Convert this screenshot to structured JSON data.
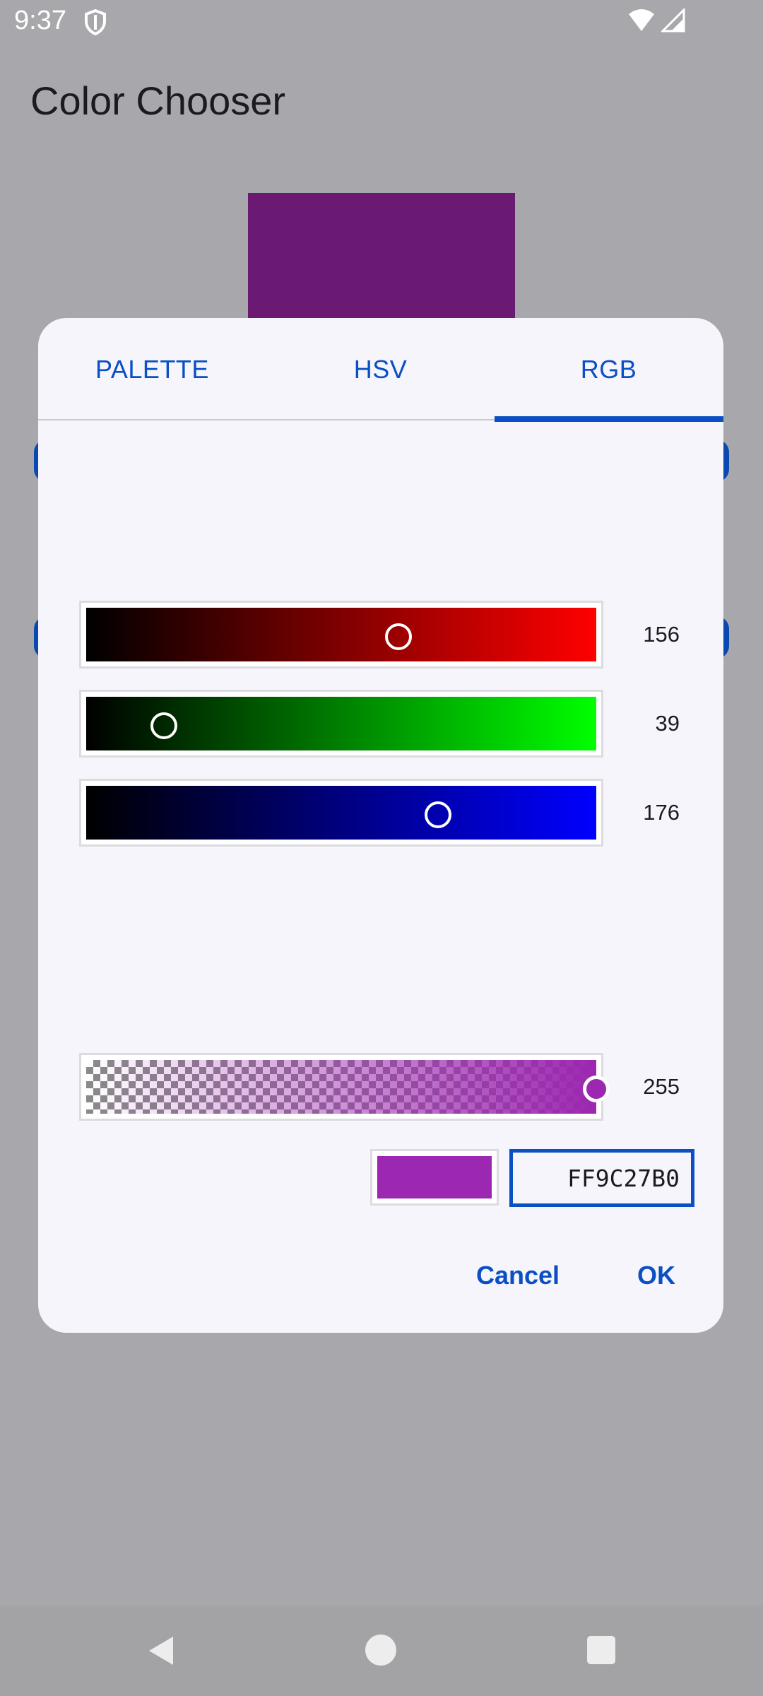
{
  "status_bar": {
    "time": "9:37"
  },
  "app": {
    "title": "Color Chooser"
  },
  "dialog": {
    "tabs": [
      {
        "label": "PALETTE",
        "selected": false
      },
      {
        "label": "HSV",
        "selected": false
      },
      {
        "label": "RGB",
        "selected": true
      }
    ],
    "sliders": {
      "red": {
        "value": "156",
        "fraction": 0.612
      },
      "green": {
        "value": "39",
        "fraction": 0.153
      },
      "blue": {
        "value": "176",
        "fraction": 0.69
      },
      "alpha": {
        "value": "255",
        "fraction": 1.0
      }
    },
    "selected_color": "#9C27B0",
    "hex_value": "FF9C27B0",
    "buttons": {
      "cancel": "Cancel",
      "ok": "OK"
    }
  },
  "colors": {
    "accent": "#0A4FC4",
    "preview_behind_dialog": "#6A1A72",
    "dialog_background": "#F6F5FC",
    "scrim": "#A8A8AC"
  },
  "icons": [
    "shield-icon",
    "wifi-icon",
    "signal-icon",
    "nav-back-icon",
    "nav-home-icon",
    "nav-recents-icon"
  ]
}
